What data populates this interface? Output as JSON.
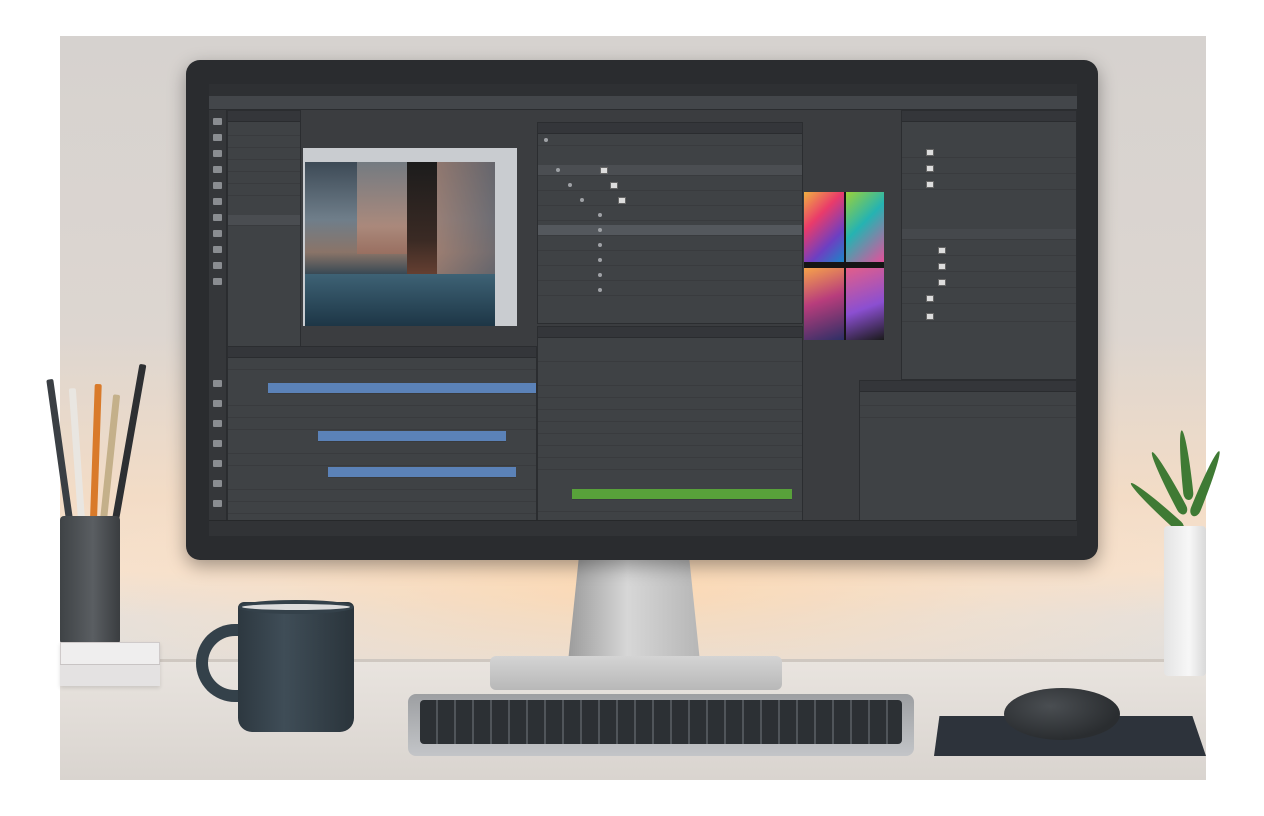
{
  "scene": "desk-with-monitor",
  "colors": {
    "wall": "#ddd6d0",
    "screen_bg": "#3b3d40",
    "selection_blue": "#5b82b8",
    "selection_green": "#58a13a",
    "mug": "#34414a",
    "desk": "#e4dfda"
  },
  "icons": [
    "pen-icon",
    "gear-icon",
    "eye-icon",
    "layer-thumbnail-icon",
    "plant-icon",
    "mug-icon",
    "mouse-icon",
    "keyboard-icon"
  ],
  "app": {
    "menubar": [
      "",
      "",
      "",
      "",
      "",
      "",
      "",
      "",
      ""
    ],
    "optionsbar": [
      "",
      "",
      "",
      "",
      "",
      "",
      "",
      "",
      "",
      ""
    ],
    "panels": {
      "layers_top": {
        "title": "",
        "rows": [
          "",
          "",
          "",
          "",
          "",
          "",
          "",
          "",
          "",
          ""
        ]
      },
      "layers_bottom": {
        "title": "",
        "rows": [
          "",
          "",
          "",
          "",
          "",
          "",
          "",
          "",
          "",
          "",
          "",
          "",
          ""
        ]
      },
      "timeline": {
        "title": "",
        "rows": [
          "",
          "",
          "",
          "",
          "",
          "",
          "",
          "",
          "",
          "",
          ""
        ]
      },
      "properties": {
        "title": "",
        "rows": [
          "",
          "",
          "",
          "",
          "",
          "",
          ""
        ]
      },
      "history": {
        "title": "",
        "rows": [
          "",
          "",
          ""
        ]
      }
    },
    "status": [
      "",
      ""
    ]
  }
}
